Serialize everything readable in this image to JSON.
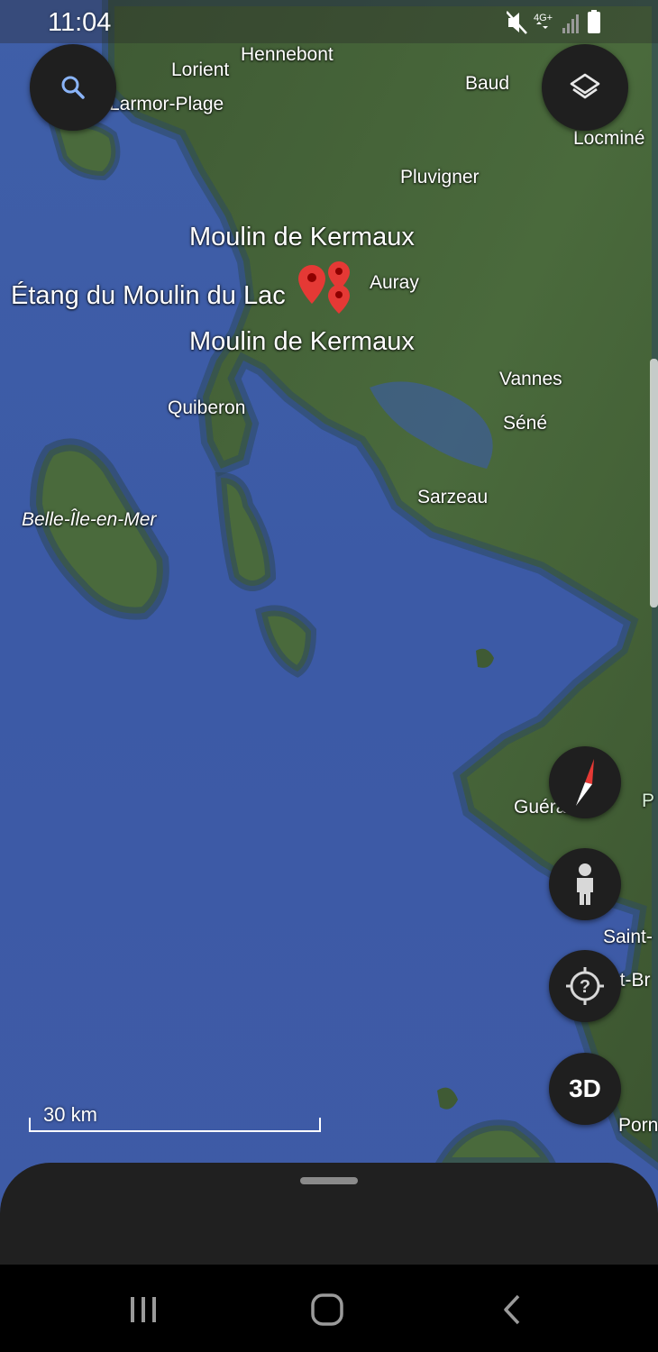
{
  "status_bar": {
    "time": "11:04",
    "network": "4G+",
    "icons": [
      "mute-icon",
      "network-4g-icon",
      "signal-icon",
      "battery-icon"
    ]
  },
  "map": {
    "type": "satellite",
    "towns": {
      "hennebont": "Hennebont",
      "lorient": "Lorient",
      "larmor": "Larmor-Plage",
      "baud": "Baud",
      "locmine": "Locminé",
      "pluvigner": "Pluvigner",
      "auray": "Auray",
      "quiberon": "Quiberon",
      "vannes": "Vannes",
      "sene": "Séné",
      "sarzeau": "Sarzeau",
      "belle_ile": "Belle-Île-en-Mer",
      "guerande": "Guérande",
      "saint1": "Saint-",
      "saint2": "nt-Br",
      "pornic": "Porn",
      "p_edge": "P"
    },
    "places": {
      "moulin_kermaux_top": "Moulin de Kermaux",
      "etang_moulin": "Étang du Moulin du Lac",
      "moulin_kermaux_bottom": "Moulin de Kermaux"
    },
    "marker_color": "#e53935",
    "marker_count": 3
  },
  "controls": {
    "search_icon": "search-icon",
    "layers_icon": "layers-icon",
    "compass_icon": "compass-icon",
    "pegman_icon": "pegman-icon",
    "help_icon": "help-icon",
    "threed_label": "3D"
  },
  "scale": {
    "label": "30 km"
  },
  "nav": {
    "icons": [
      "recents-icon",
      "home-icon",
      "back-icon"
    ]
  }
}
